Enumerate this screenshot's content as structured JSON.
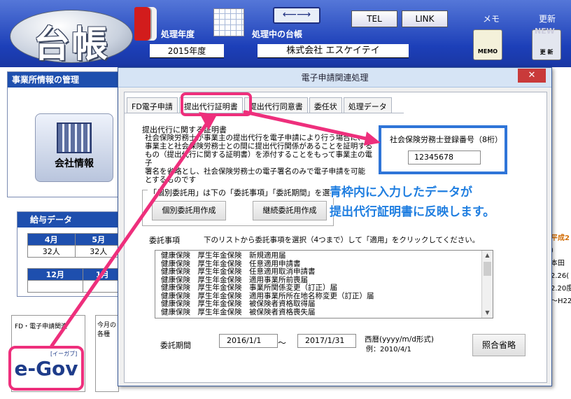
{
  "app": {
    "logo_text": "台帳",
    "processing_year_label": "処理年度",
    "ledger_label": "処理中の台帳",
    "year_value": "2015年度",
    "company_name": "株式会社 エスケイテイ",
    "arrow_glyph": "⟵⟶",
    "tel_label": "TEL",
    "link_label": "LINK",
    "memo_label": "メモ",
    "update_label": "更新",
    "memo_icon_text": "MEMO",
    "update_icon_text": "更 新",
    "new_badge": "NEW"
  },
  "background": {
    "panel_title": "事業所情報の管理",
    "company_info_label": "会社情報",
    "salary_title": "給与データ",
    "salary_rows": [
      {
        "m1": "4月",
        "m2": "5月"
      },
      {
        "m1": "32人",
        "m2": "32人"
      },
      {
        "m1": "12月",
        "m2": "1月"
      },
      {
        "m1": "",
        "m2": ""
      }
    ],
    "efiling_label": "FD・電子申請関連",
    "month_snippet_1": "今月の",
    "month_snippet_2": "各種",
    "egov_text": "e-Gov",
    "egov_sub": "[イーガブ]",
    "right_heisei": "平成2",
    "right_lines": [
      "）",
      "本田",
      "2.26(",
      "2.20度",
      "〜H22"
    ]
  },
  "dialog": {
    "title": "電子申請関連処理",
    "close_glyph": "✕",
    "tabs": [
      "FD電子申請",
      "提出代行証明書",
      "提出代行同意書",
      "委任状",
      "処理データ"
    ],
    "desc_title": "提出代行に関する証明書",
    "desc_lines": [
      "社会保険労務士が事業主の提出代行を電子申請により行う場合に、",
      "事業主と社会保険労務士との間に提出代行関係があることを証明する",
      "もの（提出代行に関する証明書）を添付することをもって事業主の電子",
      "署名を省略とし、社会保険労務士の電子署名のみで電子申請を可能",
      "とするものです"
    ],
    "reg_label": "社会保険労務士登録番号（8桁）",
    "reg_value": "12345678",
    "group_label": "「個別委託用」は下の「委託事項」「委託期間」を選択",
    "btn_individual": "個別委託用作成",
    "btn_continuous": "継続委託用作成",
    "callout_line1": "青枠内に入力したデータが",
    "callout_line2": "提出代行証明書に反映します。",
    "items_label": "委託事項",
    "items_hint": "下のリストから委託事項を選択（4つまで）して「適用」をクリックしてください。",
    "list_items": [
      "健康保険　厚生年金保険　新規適用届",
      "健康保険　厚生年金保険　任意適用申請書",
      "健康保険　厚生年金保険　任意適用取消申請書",
      "健康保険　厚生年金保険　適用事業所前喪届",
      "健康保険　厚生年金保険　事業所関係変更（訂正）届",
      "健康保険　厚生年金保険　適用事業所所在地名称変更（訂正）届",
      "健康保険　厚生年金保険　被保険者資格取得届",
      "健康保険　厚生年金保険　被保険者資格喪失届"
    ],
    "period_label": "委託期間",
    "date_from": "2016/1/1",
    "tilde": "〜",
    "date_to": "2017/1/31",
    "date_format_line1": "西暦(yyyy/m/d形式)",
    "date_format_line2": "例：2010/4/1",
    "btn_omit": "照合省略"
  },
  "colors": {
    "header_blue": "#1c3fb8",
    "highlight_pink": "#ee2f7c",
    "frame_blue": "#2f75d8",
    "callout_text": "#1f7ee0"
  }
}
